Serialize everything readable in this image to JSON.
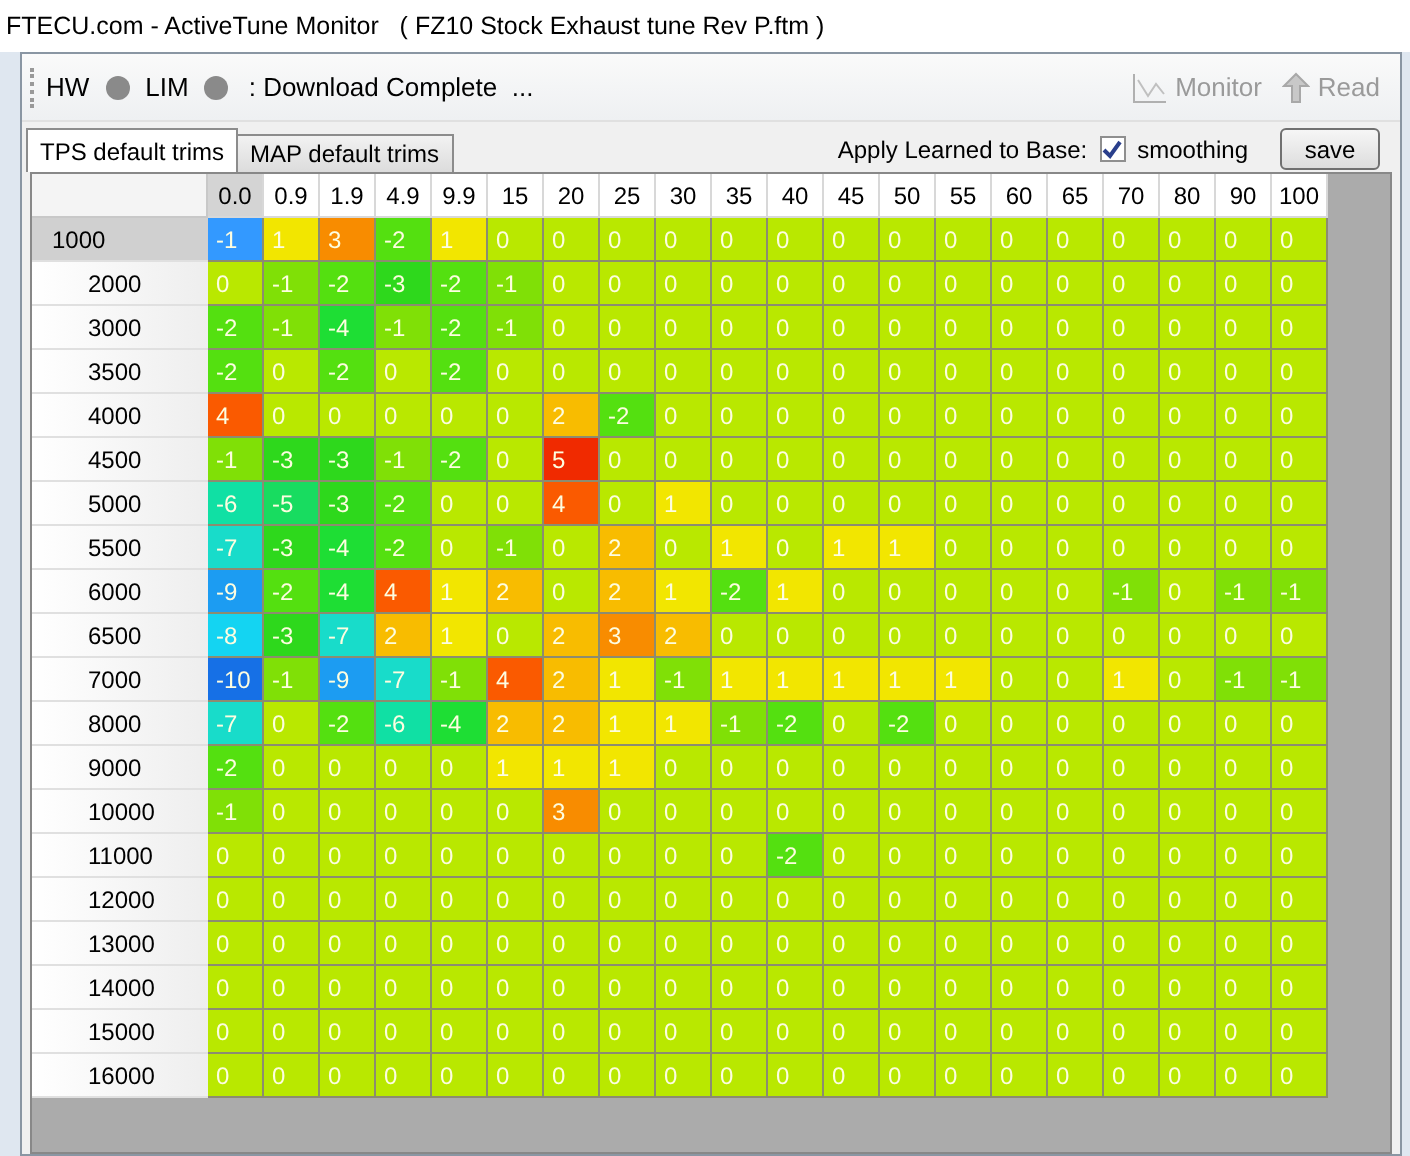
{
  "window": {
    "title": "FTECU.com - ActiveTune Monitor   ( FZ10 Stock Exhaust tune Rev P.ftm )"
  },
  "toolbar": {
    "indicators": [
      {
        "label": "HW",
        "on": false
      },
      {
        "label": "LIM",
        "on": false
      }
    ],
    "status": ": Download Complete  ...",
    "buttons": [
      {
        "label": "Monitor",
        "kind": "monitor",
        "disabled": true
      },
      {
        "label": "Read",
        "kind": "read",
        "disabled": true
      }
    ]
  },
  "tabs": [
    {
      "label": "TPS default trims",
      "selected": true
    },
    {
      "label": "MAP default trims",
      "selected": false
    }
  ],
  "apply": {
    "label": "Apply Learned to Base:",
    "checkbox": {
      "label": "smoothing",
      "checked": true
    },
    "save": "save"
  },
  "table": {
    "columns": [
      {
        "label": "0.0",
        "selected": true
      },
      {
        "label": "0.9",
        "selected": false
      },
      {
        "label": "1.9",
        "selected": false
      },
      {
        "label": "4.9",
        "selected": false
      },
      {
        "label": "9.9",
        "selected": false
      },
      {
        "label": "15",
        "selected": false
      },
      {
        "label": "20",
        "selected": false
      },
      {
        "label": "25",
        "selected": false
      },
      {
        "label": "30",
        "selected": false
      },
      {
        "label": "35",
        "selected": false
      },
      {
        "label": "40",
        "selected": false
      },
      {
        "label": "45",
        "selected": false
      },
      {
        "label": "50",
        "selected": false
      },
      {
        "label": "55",
        "selected": false
      },
      {
        "label": "60",
        "selected": false
      },
      {
        "label": "65",
        "selected": false
      },
      {
        "label": "70",
        "selected": false
      },
      {
        "label": "80",
        "selected": false
      },
      {
        "label": "90",
        "selected": false
      },
      {
        "label": "100",
        "selected": false
      }
    ],
    "rows": [
      {
        "rpm": "1000",
        "selected": true,
        "cells": [
          "-1",
          "1",
          "3",
          "-2",
          "1",
          "0",
          "0",
          "0",
          "0",
          "0",
          "0",
          "0",
          "0",
          "0",
          "0",
          "0",
          "0",
          "0",
          "0",
          "0"
        ]
      },
      {
        "rpm": "2000",
        "selected": false,
        "cells": [
          "0",
          "-1",
          "-2",
          "-3",
          "-2",
          "-1",
          "0",
          "0",
          "0",
          "0",
          "0",
          "0",
          "0",
          "0",
          "0",
          "0",
          "0",
          "0",
          "0",
          "0"
        ]
      },
      {
        "rpm": "3000",
        "selected": false,
        "cells": [
          "-2",
          "-1",
          "-4",
          "-1",
          "-2",
          "-1",
          "0",
          "0",
          "0",
          "0",
          "0",
          "0",
          "0",
          "0",
          "0",
          "0",
          "0",
          "0",
          "0",
          "0"
        ]
      },
      {
        "rpm": "3500",
        "selected": false,
        "cells": [
          "-2",
          "0",
          "-2",
          "0",
          "-2",
          "0",
          "0",
          "0",
          "0",
          "0",
          "0",
          "0",
          "0",
          "0",
          "0",
          "0",
          "0",
          "0",
          "0",
          "0"
        ]
      },
      {
        "rpm": "4000",
        "selected": false,
        "cells": [
          "4",
          "0",
          "0",
          "0",
          "0",
          "0",
          "2",
          "-2",
          "0",
          "0",
          "0",
          "0",
          "0",
          "0",
          "0",
          "0",
          "0",
          "0",
          "0",
          "0"
        ]
      },
      {
        "rpm": "4500",
        "selected": false,
        "cells": [
          "-1",
          "-3",
          "-3",
          "-1",
          "-2",
          "0",
          "5",
          "0",
          "0",
          "0",
          "0",
          "0",
          "0",
          "0",
          "0",
          "0",
          "0",
          "0",
          "0",
          "0"
        ]
      },
      {
        "rpm": "5000",
        "selected": false,
        "cells": [
          "-6",
          "-5",
          "-3",
          "-2",
          "0",
          "0",
          "4",
          "0",
          "1",
          "0",
          "0",
          "0",
          "0",
          "0",
          "0",
          "0",
          "0",
          "0",
          "0",
          "0"
        ]
      },
      {
        "rpm": "5500",
        "selected": false,
        "cells": [
          "-7",
          "-3",
          "-4",
          "-2",
          "0",
          "-1",
          "0",
          "2",
          "0",
          "1",
          "0",
          "1",
          "1",
          "0",
          "0",
          "0",
          "0",
          "0",
          "0",
          "0"
        ]
      },
      {
        "rpm": "6000",
        "selected": false,
        "cells": [
          "-9",
          "-2",
          "-4",
          "4",
          "1",
          "2",
          "0",
          "2",
          "1",
          "-2",
          "1",
          "0",
          "0",
          "0",
          "0",
          "0",
          "-1",
          "0",
          "-1",
          "-1"
        ]
      },
      {
        "rpm": "6500",
        "selected": false,
        "cells": [
          "-8",
          "-3",
          "-7",
          "2",
          "1",
          "0",
          "2",
          "3",
          "2",
          "0",
          "0",
          "0",
          "0",
          "0",
          "0",
          "0",
          "0",
          "0",
          "0",
          "0"
        ]
      },
      {
        "rpm": "7000",
        "selected": false,
        "cells": [
          "-10",
          "-1",
          "-9",
          "-7",
          "-1",
          "4",
          "2",
          "1",
          "-1",
          "1",
          "1",
          "1",
          "1",
          "1",
          "0",
          "0",
          "1",
          "0",
          "-1",
          "-1"
        ]
      },
      {
        "rpm": "8000",
        "selected": false,
        "cells": [
          "-7",
          "0",
          "-2",
          "-6",
          "-4",
          "2",
          "2",
          "1",
          "1",
          "-1",
          "-2",
          "0",
          "-2",
          "0",
          "0",
          "0",
          "0",
          "0",
          "0",
          "0"
        ]
      },
      {
        "rpm": "9000",
        "selected": false,
        "cells": [
          "-2",
          "0",
          "0",
          "0",
          "0",
          "1",
          "1",
          "1",
          "0",
          "0",
          "0",
          "0",
          "0",
          "0",
          "0",
          "0",
          "0",
          "0",
          "0",
          "0"
        ]
      },
      {
        "rpm": "10000",
        "selected": false,
        "cells": [
          "-1",
          "0",
          "0",
          "0",
          "0",
          "0",
          "3",
          "0",
          "0",
          "0",
          "0",
          "0",
          "0",
          "0",
          "0",
          "0",
          "0",
          "0",
          "0",
          "0"
        ]
      },
      {
        "rpm": "11000",
        "selected": false,
        "cells": [
          "0",
          "0",
          "0",
          "0",
          "0",
          "0",
          "0",
          "0",
          "0",
          "0",
          "-2",
          "0",
          "0",
          "0",
          "0",
          "0",
          "0",
          "0",
          "0",
          "0"
        ]
      },
      {
        "rpm": "12000",
        "selected": false,
        "cells": [
          "0",
          "0",
          "0",
          "0",
          "0",
          "0",
          "0",
          "0",
          "0",
          "0",
          "0",
          "0",
          "0",
          "0",
          "0",
          "0",
          "0",
          "0",
          "0",
          "0"
        ]
      },
      {
        "rpm": "13000",
        "selected": false,
        "cells": [
          "0",
          "0",
          "0",
          "0",
          "0",
          "0",
          "0",
          "0",
          "0",
          "0",
          "0",
          "0",
          "0",
          "0",
          "0",
          "0",
          "0",
          "0",
          "0",
          "0"
        ]
      },
      {
        "rpm": "14000",
        "selected": false,
        "cells": [
          "0",
          "0",
          "0",
          "0",
          "0",
          "0",
          "0",
          "0",
          "0",
          "0",
          "0",
          "0",
          "0",
          "0",
          "0",
          "0",
          "0",
          "0",
          "0",
          "0"
        ]
      },
      {
        "rpm": "15000",
        "selected": false,
        "cells": [
          "0",
          "0",
          "0",
          "0",
          "0",
          "0",
          "0",
          "0",
          "0",
          "0",
          "0",
          "0",
          "0",
          "0",
          "0",
          "0",
          "0",
          "0",
          "0",
          "0"
        ]
      },
      {
        "rpm": "16000",
        "selected": false,
        "cells": [
          "0",
          "0",
          "0",
          "0",
          "0",
          "0",
          "0",
          "0",
          "0",
          "0",
          "0",
          "0",
          "0",
          "0",
          "0",
          "0",
          "0",
          "0",
          "0",
          "0"
        ]
      }
    ]
  }
}
